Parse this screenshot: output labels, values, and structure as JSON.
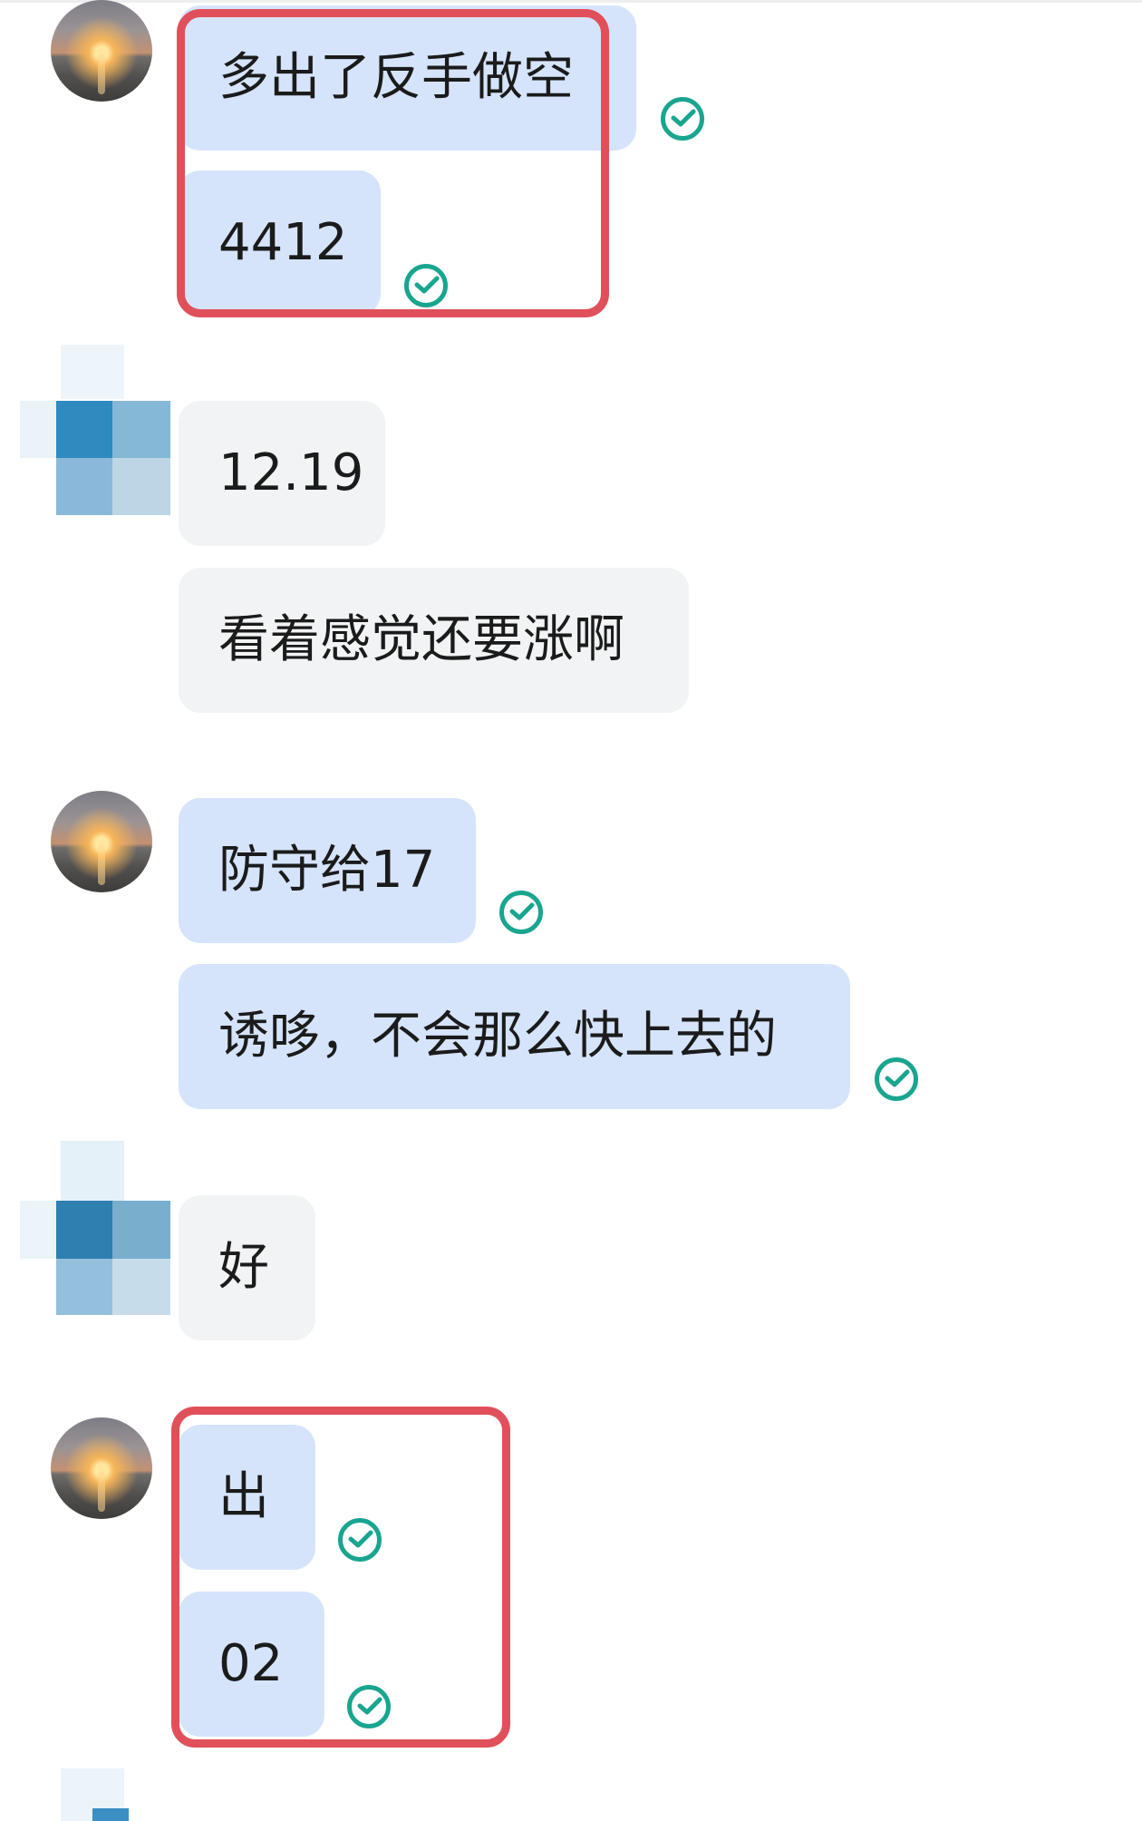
{
  "colors": {
    "outgoing_bubble": "#d6e4fb",
    "incoming_bubble": "#f2f3f5",
    "read_check": "#19a58f",
    "highlight_box": "#e0505a"
  },
  "messages": [
    {
      "sender": "self",
      "text": "多出了反手做空",
      "status": "read"
    },
    {
      "sender": "self",
      "text": "4412",
      "status": "read"
    },
    {
      "sender": "other",
      "text": "12.19"
    },
    {
      "sender": "other",
      "text": "看着感觉还要涨啊"
    },
    {
      "sender": "self",
      "text": "防守给17",
      "status": "read"
    },
    {
      "sender": "self",
      "text": "诱哆，不会那么快上去的",
      "status": "read"
    },
    {
      "sender": "other",
      "text": "好"
    },
    {
      "sender": "self",
      "text": "出",
      "status": "read"
    },
    {
      "sender": "self",
      "text": "02",
      "status": "read"
    }
  ],
  "avatars": {
    "self": {
      "icon": "sunset-avatar-icon"
    },
    "other": {
      "icon": "pixelated-avatar-icon"
    }
  }
}
